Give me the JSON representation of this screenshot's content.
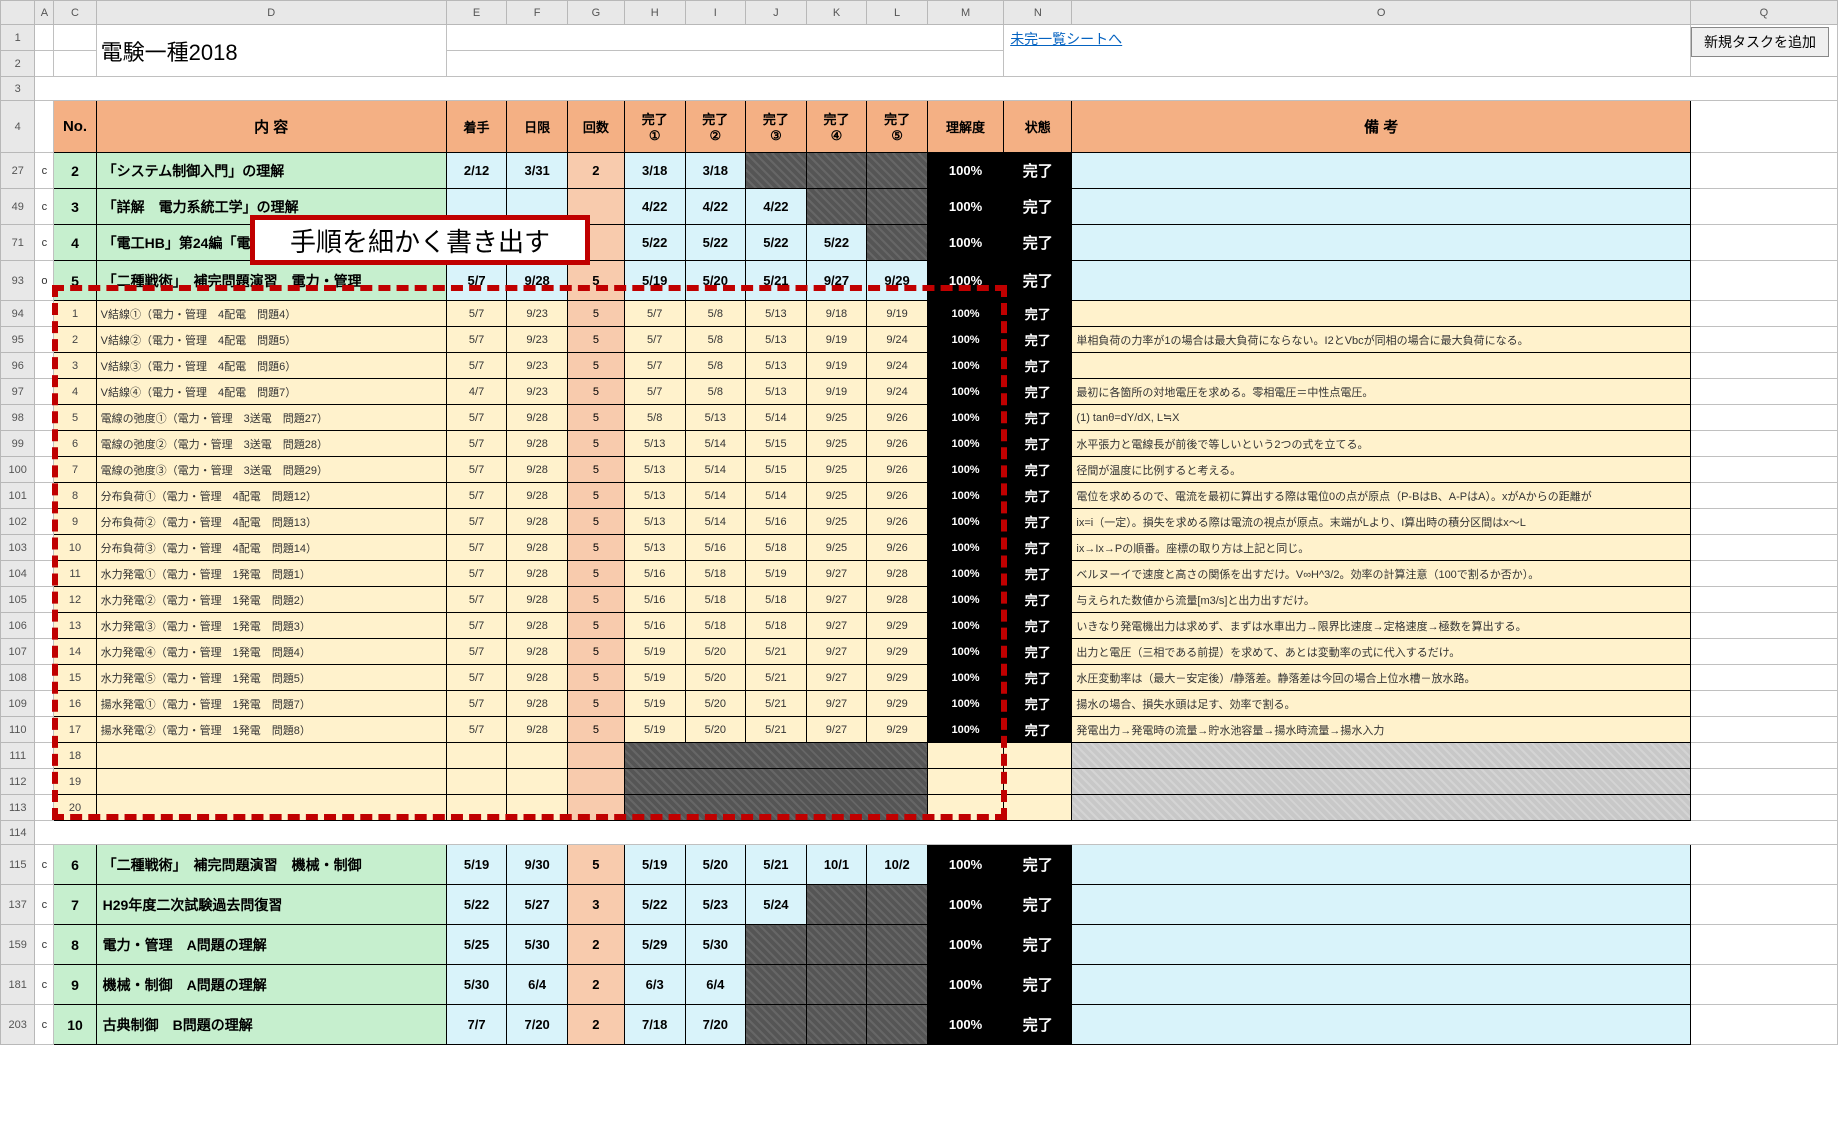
{
  "title": "電験一種2018",
  "link_text": "未完一覧シートへ",
  "button_text": "新規タスクを追加",
  "callout": "手順を細かく書き出す",
  "col_letters": [
    "",
    "A",
    "C",
    "D",
    "E",
    "F",
    "G",
    "H",
    "I",
    "J",
    "K",
    "L",
    "M",
    "N",
    "O",
    "Q"
  ],
  "headers": {
    "no": "No.",
    "content": "内 容",
    "start": "着手",
    "due": "日限",
    "times": "回数",
    "c1": "完了\n①",
    "c2": "完了\n②",
    "c3": "完了\n③",
    "c4": "完了\n④",
    "c5": "完了\n⑤",
    "und": "理解度",
    "state": "状態",
    "remark": "備 考"
  },
  "main_before": [
    {
      "rn": "27",
      "mark": "c",
      "no": "2",
      "d": "「システム制御入門」の理解",
      "e": "2/12",
      "f": "3/31",
      "g": "2",
      "h": "3/18",
      "i": "3/18",
      "j": "",
      "k": "",
      "l": "",
      "m": "100%",
      "n": "完了",
      "o": ""
    },
    {
      "rn": "49",
      "mark": "c",
      "no": "3",
      "d": "「詳解　電力系統工学」の理解",
      "e": "",
      "f": "",
      "g": "",
      "h": "4/22",
      "i": "4/22",
      "j": "4/22",
      "k": "",
      "l": "",
      "m": "100%",
      "n": "完了",
      "o": ""
    },
    {
      "rn": "71",
      "mark": "c",
      "no": "4",
      "d": "「電工HB」第24編「電",
      "e": "",
      "f": "",
      "g": "",
      "h": "5/22",
      "i": "5/22",
      "j": "5/22",
      "k": "5/22",
      "l": "",
      "m": "100%",
      "n": "完了",
      "o": ""
    },
    {
      "rn": "93",
      "mark": "o",
      "no": "5",
      "d": "「二種戦術」　補完問題演習　電力・管理",
      "e": "5/7",
      "f": "9/28",
      "g": "5",
      "h": "5/19",
      "i": "5/20",
      "j": "5/21",
      "k": "9/27",
      "l": "9/29",
      "m": "100%",
      "n": "完了",
      "o": ""
    }
  ],
  "subs": [
    {
      "rn": "94",
      "no": "1",
      "d": "V結線①（電力・管理　4配電　問題4）",
      "e": "5/7",
      "f": "9/23",
      "g": "5",
      "h": "5/7",
      "i": "5/8",
      "j": "5/13",
      "k": "9/18",
      "l": "9/19",
      "m": "100%",
      "n": "完了",
      "o": ""
    },
    {
      "rn": "95",
      "no": "2",
      "d": "V結線②（電力・管理　4配電　問題5）",
      "e": "5/7",
      "f": "9/23",
      "g": "5",
      "h": "5/7",
      "i": "5/8",
      "j": "5/13",
      "k": "9/19",
      "l": "9/24",
      "m": "100%",
      "n": "完了",
      "o": "単相負荷の力率が1の場合は最大負荷にならない。I2とVbcが同相の場合に最大負荷になる。"
    },
    {
      "rn": "96",
      "no": "3",
      "d": "V結線③（電力・管理　4配電　問題6）",
      "e": "5/7",
      "f": "9/23",
      "g": "5",
      "h": "5/7",
      "i": "5/8",
      "j": "5/13",
      "k": "9/19",
      "l": "9/24",
      "m": "100%",
      "n": "完了",
      "o": ""
    },
    {
      "rn": "97",
      "no": "4",
      "d": "V結線④（電力・管理　4配電　問題7）",
      "e": "4/7",
      "f": "9/23",
      "g": "5",
      "h": "5/7",
      "i": "5/8",
      "j": "5/13",
      "k": "9/19",
      "l": "9/24",
      "m": "100%",
      "n": "完了",
      "o": "最初に各箇所の対地電圧を求める。零相電圧＝中性点電圧。"
    },
    {
      "rn": "98",
      "no": "5",
      "d": "電線の弛度①（電力・管理　3送電　問題27）",
      "e": "5/7",
      "f": "9/28",
      "g": "5",
      "h": "5/8",
      "i": "5/13",
      "j": "5/14",
      "k": "9/25",
      "l": "9/26",
      "m": "100%",
      "n": "完了",
      "o": "(1) tanθ=dY/dX, L≒X"
    },
    {
      "rn": "99",
      "no": "6",
      "d": "電線の弛度②（電力・管理　3送電　問題28）",
      "e": "5/7",
      "f": "9/28",
      "g": "5",
      "h": "5/13",
      "i": "5/14",
      "j": "5/15",
      "k": "9/25",
      "l": "9/26",
      "m": "100%",
      "n": "完了",
      "o": "水平張力と電線長が前後で等しいという2つの式を立てる。"
    },
    {
      "rn": "100",
      "no": "7",
      "d": "電線の弛度③（電力・管理　3送電　問題29）",
      "e": "5/7",
      "f": "9/28",
      "g": "5",
      "h": "5/13",
      "i": "5/14",
      "j": "5/15",
      "k": "9/25",
      "l": "9/26",
      "m": "100%",
      "n": "完了",
      "o": "径間が温度に比例すると考える。"
    },
    {
      "rn": "101",
      "no": "8",
      "d": "分布負荷①（電力・管理　4配電　問題12）",
      "e": "5/7",
      "f": "9/28",
      "g": "5",
      "h": "5/13",
      "i": "5/14",
      "j": "5/14",
      "k": "9/25",
      "l": "9/26",
      "m": "100%",
      "n": "完了",
      "o": "電位を求めるので、電流を最初に算出する際は電位0の点が原点（P-BはB、A-PはA）。xがAからの距離が"
    },
    {
      "rn": "102",
      "no": "9",
      "d": "分布負荷②（電力・管理　4配電　問題13）",
      "e": "5/7",
      "f": "9/28",
      "g": "5",
      "h": "5/13",
      "i": "5/14",
      "j": "5/16",
      "k": "9/25",
      "l": "9/26",
      "m": "100%",
      "n": "完了",
      "o": "ix=i（一定）。損失を求める際は電流の視点が原点。末端がLより、I算出時の積分区間はx～L"
    },
    {
      "rn": "103",
      "no": "10",
      "d": "分布負荷③（電力・管理　4配電　問題14）",
      "e": "5/7",
      "f": "9/28",
      "g": "5",
      "h": "5/13",
      "i": "5/16",
      "j": "5/18",
      "k": "9/25",
      "l": "9/26",
      "m": "100%",
      "n": "完了",
      "o": "ix→Ix→Pの順番。座標の取り方は上記と同じ。"
    },
    {
      "rn": "104",
      "no": "11",
      "d": "水力発電①（電力・管理　1発電　問題1）",
      "e": "5/7",
      "f": "9/28",
      "g": "5",
      "h": "5/16",
      "i": "5/18",
      "j": "5/19",
      "k": "9/27",
      "l": "9/28",
      "m": "100%",
      "n": "完了",
      "o": "ベルヌーイで速度と高さの関係を出すだけ。V∞H^3/2。効率の計算注意（100で割るか否か）。"
    },
    {
      "rn": "105",
      "no": "12",
      "d": "水力発電②（電力・管理　1発電　問題2）",
      "e": "5/7",
      "f": "9/28",
      "g": "5",
      "h": "5/16",
      "i": "5/18",
      "j": "5/18",
      "k": "9/27",
      "l": "9/28",
      "m": "100%",
      "n": "完了",
      "o": "与えられた数値から流量[m3/s]と出力出すだけ。"
    },
    {
      "rn": "106",
      "no": "13",
      "d": "水力発電③（電力・管理　1発電　問題3）",
      "e": "5/7",
      "f": "9/28",
      "g": "5",
      "h": "5/16",
      "i": "5/18",
      "j": "5/18",
      "k": "9/27",
      "l": "9/29",
      "m": "100%",
      "n": "完了",
      "o": "いきなり発電機出力は求めず、まずは水車出力→限界比速度→定格速度→極数を算出する。"
    },
    {
      "rn": "107",
      "no": "14",
      "d": "水力発電④（電力・管理　1発電　問題4）",
      "e": "5/7",
      "f": "9/28",
      "g": "5",
      "h": "5/19",
      "i": "5/20",
      "j": "5/21",
      "k": "9/27",
      "l": "9/29",
      "m": "100%",
      "n": "完了",
      "o": "出力と電圧（三相である前提）を求めて、あとは変動率の式に代入するだけ。"
    },
    {
      "rn": "108",
      "no": "15",
      "d": "水力発電⑤（電力・管理　1発電　問題5）",
      "e": "5/7",
      "f": "9/28",
      "g": "5",
      "h": "5/19",
      "i": "5/20",
      "j": "5/21",
      "k": "9/27",
      "l": "9/29",
      "m": "100%",
      "n": "完了",
      "o": "水圧変動率は（最大－安定後）/静落差。静落差は今回の場合上位水槽－放水路。"
    },
    {
      "rn": "109",
      "no": "16",
      "d": "揚水発電①（電力・管理　1発電　問題7）",
      "e": "5/7",
      "f": "9/28",
      "g": "5",
      "h": "5/19",
      "i": "5/20",
      "j": "5/21",
      "k": "9/27",
      "l": "9/29",
      "m": "100%",
      "n": "完了",
      "o": "揚水の場合、損失水頭は足す、効率で割る。"
    },
    {
      "rn": "110",
      "no": "17",
      "d": "揚水発電②（電力・管理　1発電　問題8）",
      "e": "5/7",
      "f": "9/28",
      "g": "5",
      "h": "5/19",
      "i": "5/20",
      "j": "5/21",
      "k": "9/27",
      "l": "9/29",
      "m": "100%",
      "n": "完了",
      "o": "発電出力→発電時の流量→貯水池容量→揚水時流量→揚水入力"
    }
  ],
  "empty_rows": [
    {
      "rn": "111",
      "no": "18"
    },
    {
      "rn": "112",
      "no": "19"
    },
    {
      "rn": "113",
      "no": "20"
    }
  ],
  "gap_rn": "114",
  "main_after": [
    {
      "rn": "115",
      "mark": "c",
      "no": "6",
      "d": "「二種戦術」　補完問題演習　機械・制御",
      "e": "5/19",
      "f": "9/30",
      "g": "5",
      "h": "5/19",
      "i": "5/20",
      "j": "5/21",
      "k": "10/1",
      "l": "10/2",
      "m": "100%",
      "n": "完了",
      "o": ""
    },
    {
      "rn": "137",
      "mark": "c",
      "no": "7",
      "d": "H29年度二次試験過去問復習",
      "e": "5/22",
      "f": "5/27",
      "g": "3",
      "h": "5/22",
      "i": "5/23",
      "j": "5/24",
      "k": "",
      "l": "",
      "m": "100%",
      "n": "完了",
      "o": ""
    },
    {
      "rn": "159",
      "mark": "c",
      "no": "8",
      "d": "電力・管理　A問題の理解",
      "e": "5/25",
      "f": "5/30",
      "g": "2",
      "h": "5/29",
      "i": "5/30",
      "j": "",
      "k": "",
      "l": "",
      "m": "100%",
      "n": "完了",
      "o": ""
    },
    {
      "rn": "181",
      "mark": "c",
      "no": "9",
      "d": "機械・制御　A問題の理解",
      "e": "5/30",
      "f": "6/4",
      "g": "2",
      "h": "6/3",
      "i": "6/4",
      "j": "",
      "k": "",
      "l": "",
      "m": "100%",
      "n": "完了",
      "o": ""
    },
    {
      "rn": "203",
      "mark": "c",
      "no": "10",
      "d": "古典制御　B問題の理解",
      "e": "7/7",
      "f": "7/20",
      "g": "2",
      "h": "7/18",
      "i": "7/20",
      "j": "",
      "k": "",
      "l": "",
      "m": "100%",
      "n": "完了",
      "o": ""
    }
  ]
}
